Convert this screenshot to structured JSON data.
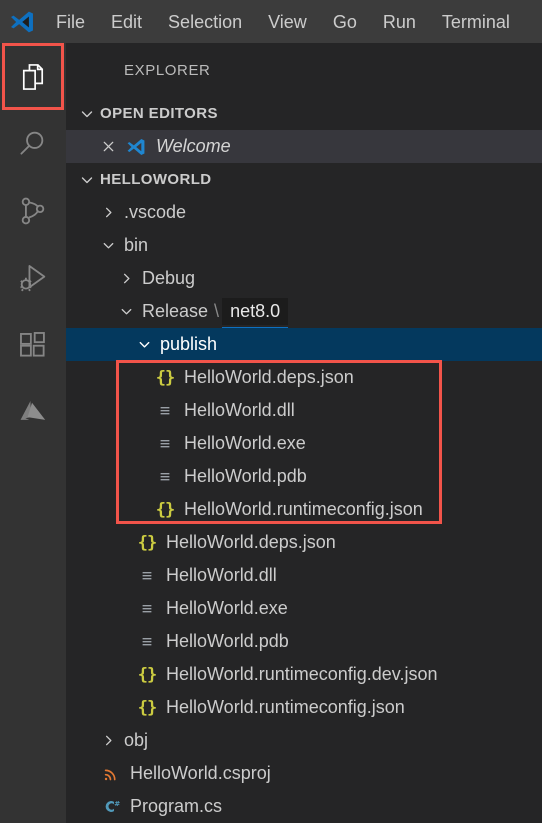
{
  "window": {
    "logo_icon": "vscode-logo-icon"
  },
  "menubar": {
    "items": [
      {
        "label": "File"
      },
      {
        "label": "Edit"
      },
      {
        "label": "Selection"
      },
      {
        "label": "View"
      },
      {
        "label": "Go"
      },
      {
        "label": "Run"
      },
      {
        "label": "Terminal"
      }
    ]
  },
  "activitybar": {
    "items": [
      {
        "name": "explorer",
        "icon": "files-icon",
        "active": true
      },
      {
        "name": "search",
        "icon": "search-icon",
        "active": false
      },
      {
        "name": "source-control",
        "icon": "source-control-icon",
        "active": false
      },
      {
        "name": "run-and-debug",
        "icon": "run-and-debug-icon",
        "active": false
      },
      {
        "name": "extensions",
        "icon": "extensions-icon",
        "active": false
      },
      {
        "name": "azure",
        "icon": "azure-icon",
        "active": false
      }
    ]
  },
  "sidebar": {
    "title": "EXPLORER",
    "open_editors": {
      "header": "OPEN EDITORS",
      "expanded": true,
      "items": [
        {
          "label": "Welcome",
          "icon": "vscode-logo-icon",
          "close_icon": "close-icon",
          "italic": true
        }
      ]
    },
    "workspace": {
      "header": "HELLOWORLD",
      "expanded": true,
      "tree": [
        {
          "label": ".vscode",
          "type": "folder",
          "expanded": false,
          "indent": 1,
          "icon": "chevron-right-icon"
        },
        {
          "label": "bin",
          "type": "folder",
          "expanded": true,
          "indent": 1,
          "icon": "chevron-down-icon"
        },
        {
          "label": "Debug",
          "type": "folder",
          "expanded": false,
          "indent": 2,
          "icon": "chevron-right-icon"
        },
        {
          "label": "Release",
          "type": "folder",
          "expanded": true,
          "indent": 2,
          "icon": "chevron-down-icon",
          "suffix_separator": "\\",
          "badge": "net8.0"
        },
        {
          "label": "publish",
          "type": "folder",
          "expanded": true,
          "indent": 3,
          "icon": "chevron-down-icon",
          "selected": true
        },
        {
          "label": "HelloWorld.deps.json",
          "type": "file",
          "indent": 4,
          "icon": "json-icon",
          "icon_glyph": "{}"
        },
        {
          "label": "HelloWorld.dll",
          "type": "file",
          "indent": 4,
          "icon": "binary-icon",
          "icon_glyph": "≡"
        },
        {
          "label": "HelloWorld.exe",
          "type": "file",
          "indent": 4,
          "icon": "binary-icon",
          "icon_glyph": "≡"
        },
        {
          "label": "HelloWorld.pdb",
          "type": "file",
          "indent": 4,
          "icon": "binary-icon",
          "icon_glyph": "≡"
        },
        {
          "label": "HelloWorld.runtimeconfig.json",
          "type": "file",
          "indent": 4,
          "icon": "json-icon",
          "icon_glyph": "{}"
        },
        {
          "label": "HelloWorld.deps.json",
          "type": "file",
          "indent": 3,
          "icon": "json-icon",
          "icon_glyph": "{}"
        },
        {
          "label": "HelloWorld.dll",
          "type": "file",
          "indent": 3,
          "icon": "binary-icon",
          "icon_glyph": "≡"
        },
        {
          "label": "HelloWorld.exe",
          "type": "file",
          "indent": 3,
          "icon": "binary-icon",
          "icon_glyph": "≡"
        },
        {
          "label": "HelloWorld.pdb",
          "type": "file",
          "indent": 3,
          "icon": "binary-icon",
          "icon_glyph": "≡"
        },
        {
          "label": "HelloWorld.runtimeconfig.dev.json",
          "type": "file",
          "indent": 3,
          "icon": "json-icon",
          "icon_glyph": "{}"
        },
        {
          "label": "HelloWorld.runtimeconfig.json",
          "type": "file",
          "indent": 3,
          "icon": "json-icon",
          "icon_glyph": "{}"
        },
        {
          "label": "obj",
          "type": "folder",
          "expanded": false,
          "indent": 1,
          "icon": "chevron-right-icon"
        },
        {
          "label": "HelloWorld.csproj",
          "type": "file",
          "indent": 1,
          "icon": "csproj-icon",
          "icon_glyph": "ᴰ"
        },
        {
          "label": "Program.cs",
          "type": "file",
          "indent": 1,
          "icon": "csharp-icon",
          "icon_glyph": "C#"
        }
      ]
    }
  },
  "annotations": [
    {
      "name": "explorer-icon-highlight",
      "color": "#f2544a"
    },
    {
      "name": "publish-files-highlight",
      "color": "#f2544a"
    }
  ],
  "colors": {
    "menubar_bg": "#3c3c3c",
    "activitybar_bg": "#333333",
    "sidebar_bg": "#252526",
    "selection_bg": "#04395e",
    "row_hover_bg": "#37373d",
    "text": "#cccccc",
    "json_icon": "#cbcb41",
    "binary_icon": "#9aa0a6",
    "csproj_icon": "#e37933",
    "csharp_icon": "#519aba",
    "annotation": "#f2544a",
    "badge_underline": "#0e70c0"
  }
}
